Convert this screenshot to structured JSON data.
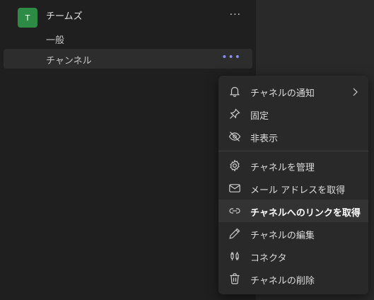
{
  "team": {
    "avatar_letter": "T",
    "name": "チームズ",
    "more_label": "···"
  },
  "channels": [
    {
      "label": "一般"
    },
    {
      "label": "チャンネル",
      "more_label": "•••"
    }
  ],
  "context_menu": {
    "items": [
      {
        "label": "チャネルの通知",
        "icon": "bell-icon",
        "has_submenu": true
      },
      {
        "label": "固定",
        "icon": "pin-icon"
      },
      {
        "label": "非表示",
        "icon": "eye-off-icon"
      },
      {
        "label": "チャネルを管理",
        "icon": "gear-icon"
      },
      {
        "label": "メール アドレスを取得",
        "icon": "mail-icon"
      },
      {
        "label": "チャネルへのリンクを取得",
        "icon": "link-icon",
        "highlighted": true
      },
      {
        "label": "チャネルの編集",
        "icon": "pencil-icon"
      },
      {
        "label": "コネクタ",
        "icon": "connector-icon"
      },
      {
        "label": "チャネルの削除",
        "icon": "trash-icon"
      }
    ]
  },
  "colors": {
    "avatar": "#2e8b46",
    "accent_more": "#8b8cf0",
    "menu_bg": "#292929"
  }
}
